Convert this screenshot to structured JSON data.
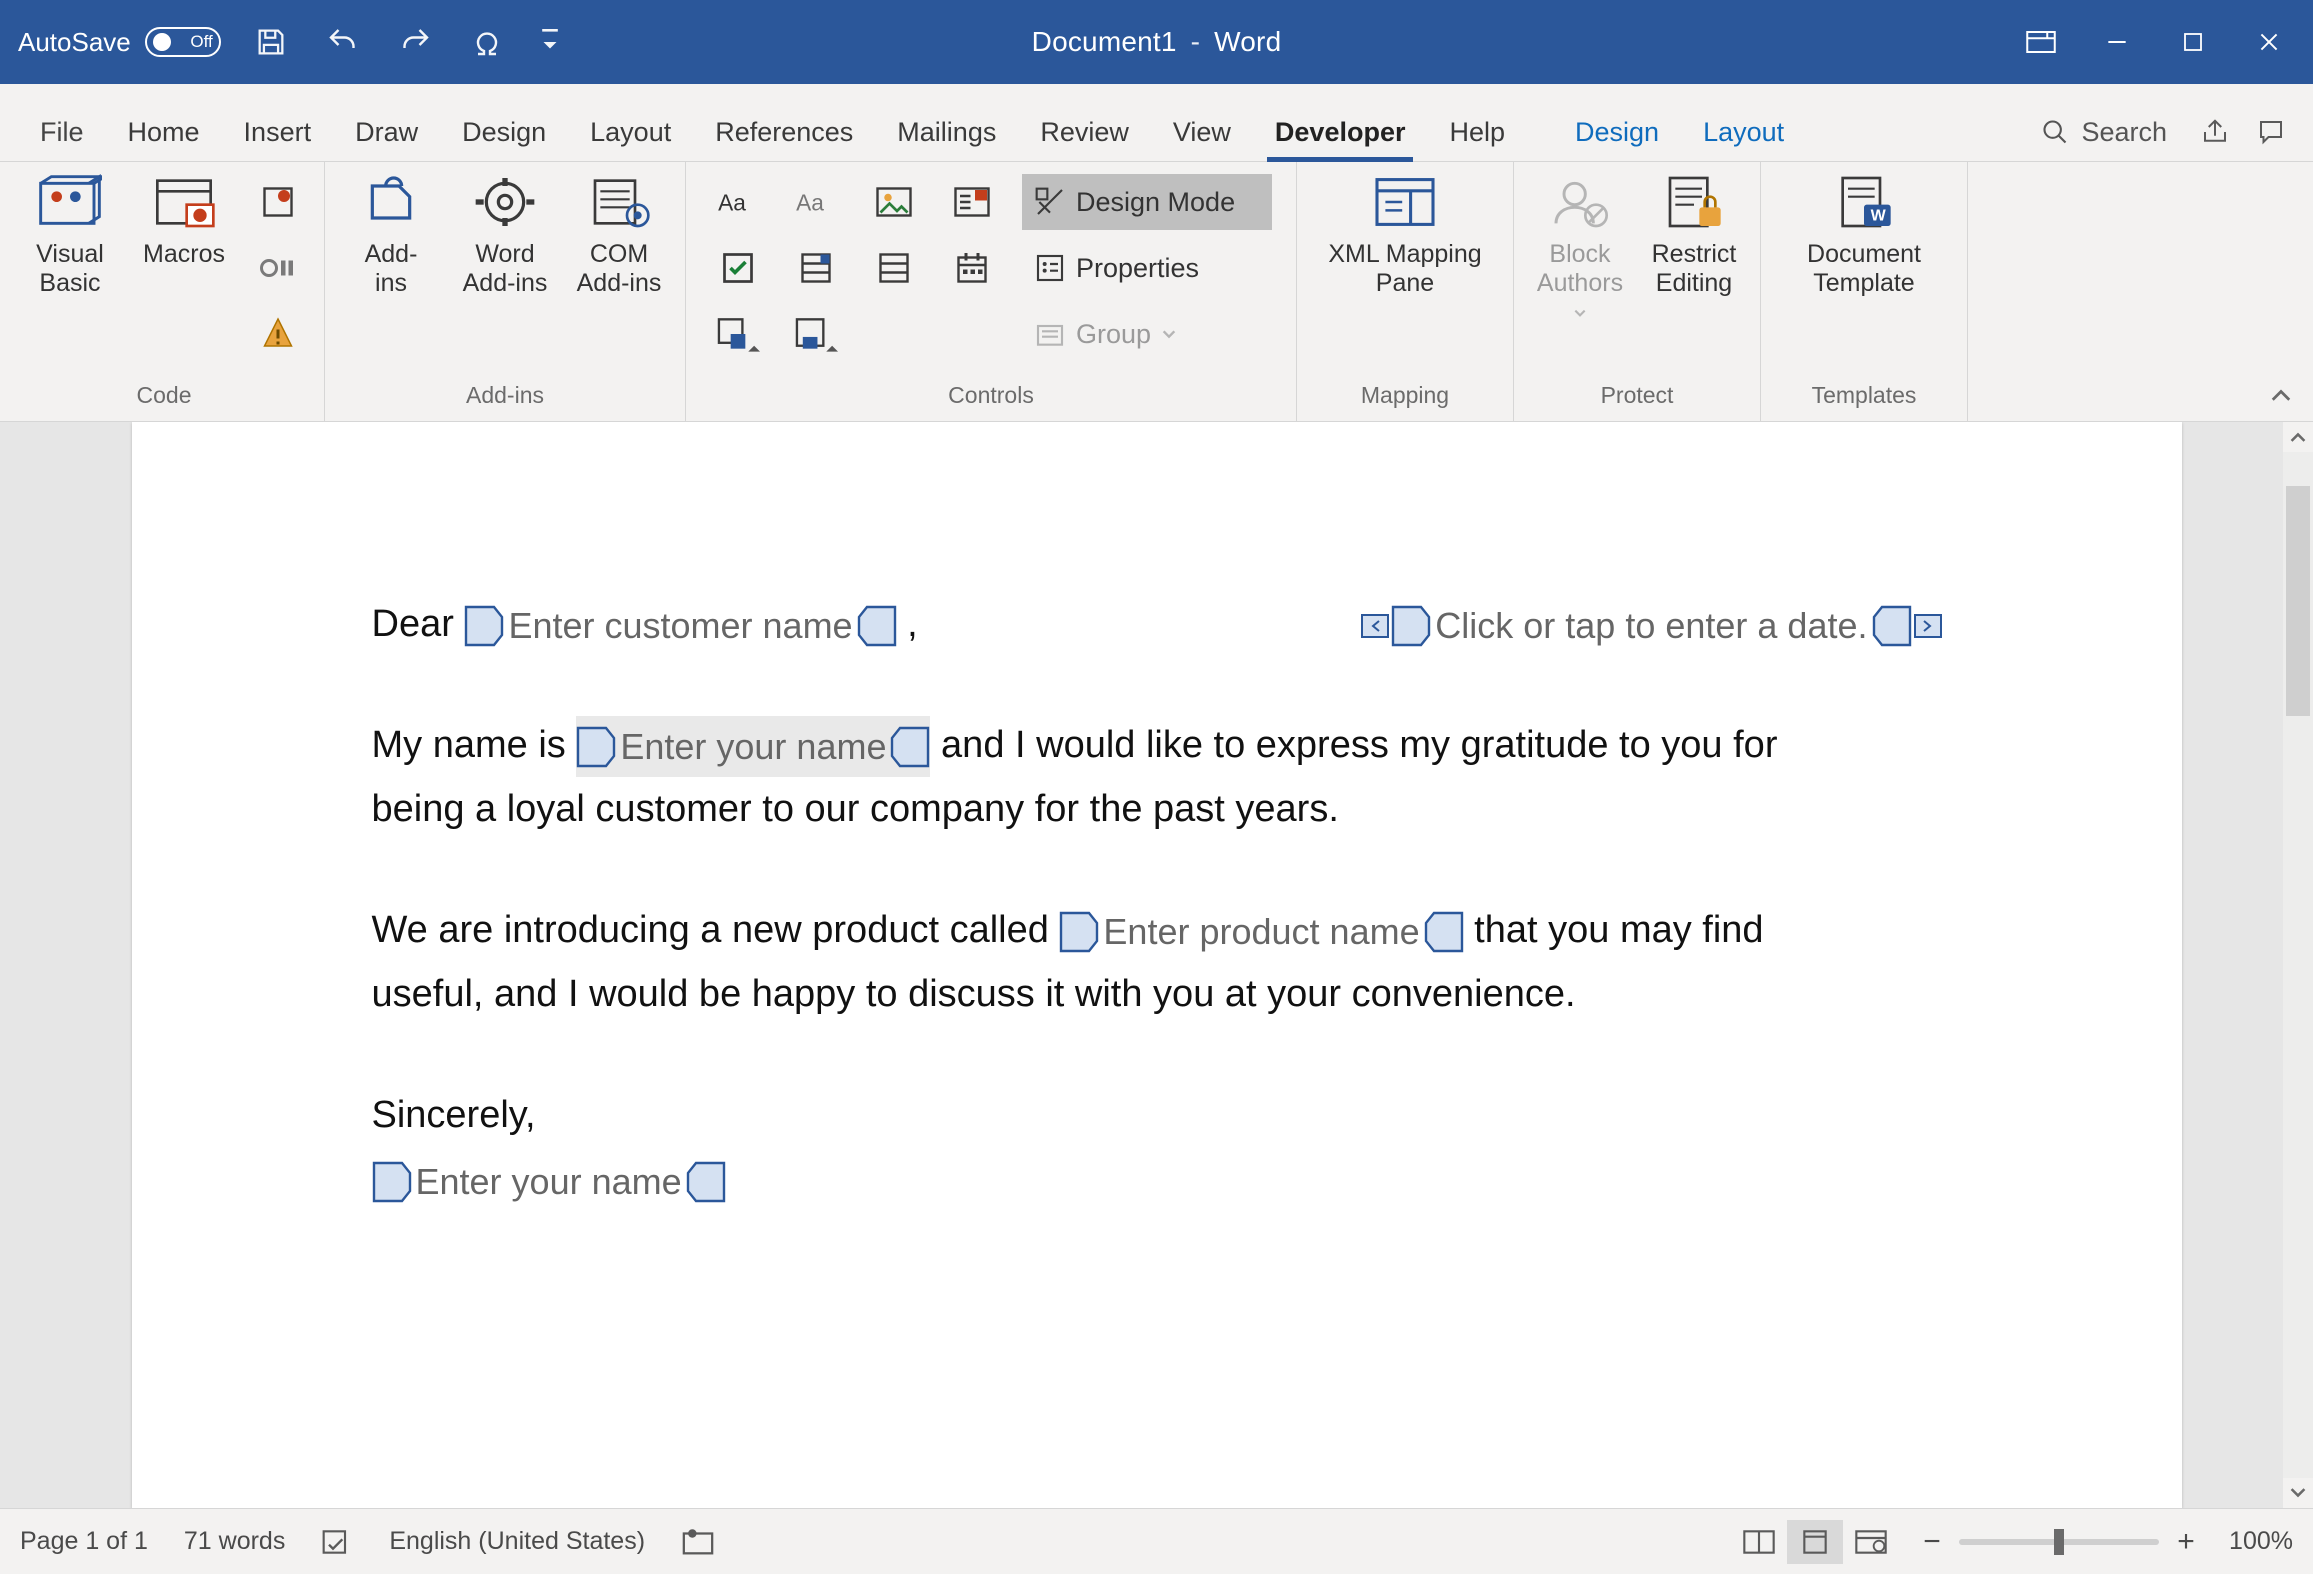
{
  "titlebar": {
    "autosave_label": "AutoSave",
    "autosave_state": "Off",
    "document": "Document1",
    "app": "Word"
  },
  "tabs": {
    "file": "File",
    "items": [
      "Home",
      "Insert",
      "Draw",
      "Design",
      "Layout",
      "References",
      "Mailings",
      "Review",
      "View",
      "Developer",
      "Help"
    ],
    "active": "Developer",
    "contextual": [
      "Design",
      "Layout"
    ],
    "search": "Search"
  },
  "ribbon": {
    "groups": {
      "code": {
        "title": "Code",
        "visual_basic": "Visual\nBasic",
        "macros": "Macros"
      },
      "addins": {
        "title": "Add-ins",
        "addins": "Add-\nins",
        "word_addins": "Word\nAdd-ins",
        "com_addins": "COM\nAdd-ins"
      },
      "controls": {
        "title": "Controls",
        "design_mode": "Design Mode",
        "properties": "Properties",
        "group": "Group"
      },
      "mapping": {
        "title": "Mapping",
        "xml_pane": "XML Mapping\nPane"
      },
      "protect": {
        "title": "Protect",
        "block_authors": "Block\nAuthors",
        "restrict": "Restrict\nEditing"
      },
      "templates": {
        "title": "Templates",
        "doc_template": "Document\nTemplate"
      }
    }
  },
  "document": {
    "dear": "Dear",
    "cc_customer": "Enter customer name",
    "comma": ",",
    "cc_date": "Click or tap to enter a date.",
    "p1_a": "My name is",
    "cc_yourname": "Enter your name",
    "p1_b": "and I would like to express my gratitude to you for being a loyal customer to our company for the past years.",
    "p2_a": "We are introducing a new product called",
    "cc_product": "Enter product name",
    "p2_b": "that you may find useful, and I would be happy to discuss it with you at your convenience.",
    "closing": "Sincerely,",
    "cc_sign": "Enter your name"
  },
  "status": {
    "page": "Page 1 of 1",
    "words": "71 words",
    "language": "English (United States)",
    "zoom": "100%"
  }
}
